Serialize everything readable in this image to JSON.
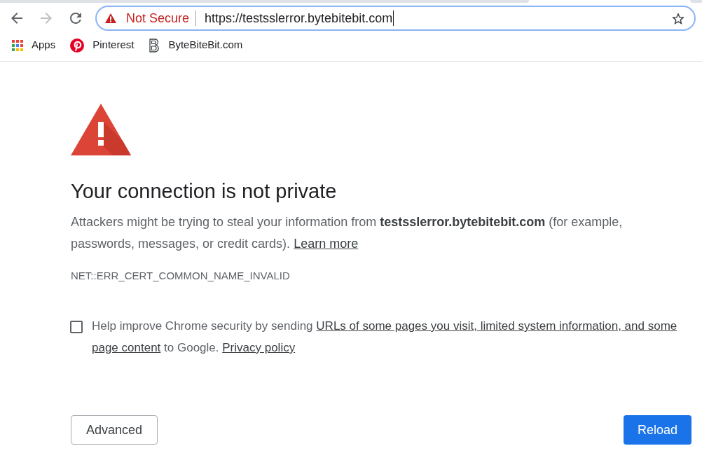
{
  "toolbar": {
    "nav_buttons": [
      {
        "kind": "back",
        "disabled": false
      },
      {
        "kind": "forward",
        "disabled": true
      },
      {
        "kind": "reload",
        "disabled": false
      }
    ],
    "address_bar": {
      "security_label": "Not Secure",
      "value": "https://testsslerror.bytebitebit.com",
      "focused": true,
      "bookmarked": false
    }
  },
  "bookmarks_bar": [
    {
      "kind": "apps",
      "label": "Apps"
    },
    {
      "kind": "pin_logo",
      "label": "Pinterest"
    },
    {
      "kind": "b_logo",
      "label": "ByteBiteBit.com"
    }
  ],
  "interstitial": {
    "heading": "Your connection is not private",
    "message": "Attackers might be trying to steal your information from **testsslerror.bytebitebit.com** (for example, passwords, messages, or credit cards).",
    "learn_more": "Learn more",
    "error_code": "NET::ERR_CERT_COMMON_NAME_INVALID",
    "opt_in": {
      "checked": false,
      "parts": [
        {
          "kind": "text",
          "text": "Help improve Chrome security by sending"
        },
        {
          "kind": "link",
          "text": "URLs of some pages you visit, limited system information, and some"
        },
        {
          "kind": "link",
          "text": "page content"
        },
        {
          "kind": "text",
          "text": "to Google."
        },
        {
          "kind": "link",
          "text": "Privacy policy"
        }
      ]
    },
    "buttons": [
      {
        "kind": "secondary",
        "label": "Advanced"
      },
      {
        "kind": "primary",
        "label": "Reload"
      }
    ]
  }
}
